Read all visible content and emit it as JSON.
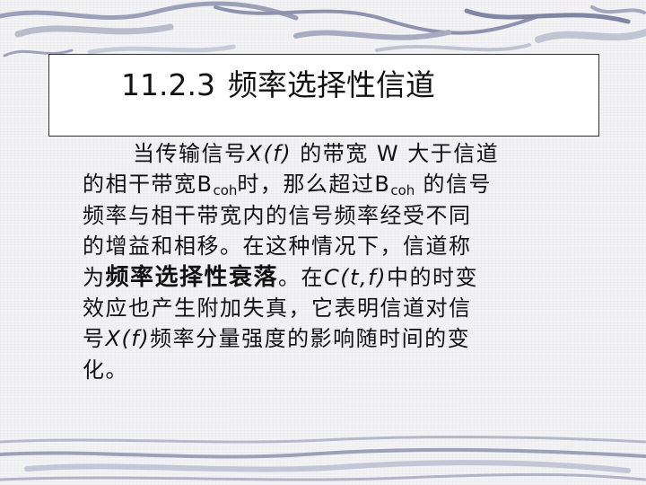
{
  "slide": {
    "title_number": "11.2.3",
    "title_text": "频率选择性信道"
  },
  "paragraph": {
    "l1_a": "当传输信号",
    "l1_signal": "X(f)",
    "l1_b": " 的带宽 W 大于信道",
    "l2_a": "的相干带宽B",
    "l2_sub1": "coh",
    "l2_b": "时，那么超过B",
    "l2_sub2": "coh",
    "l2_c": " 的信号",
    "l3": "频率与相干带宽内的信号频率经受不同",
    "l4": "的增益和相移。在这种情况下，信道称",
    "l5_a": "为",
    "l5_term": "频率选择性衰落",
    "l5_b": "。在",
    "l5_channel": "C(t,f)",
    "l5_c": "中的时变",
    "l6": "效应也产生附加失真，它表明信道对信",
    "l7_a": "号",
    "l7_signal": "X(f)",
    "l7_b": "频率分量强度的影响随时间的变",
    "l8": "化。"
  }
}
